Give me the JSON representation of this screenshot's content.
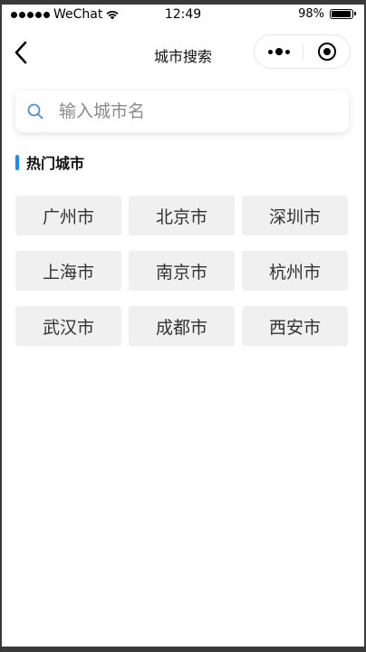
{
  "status_bar": {
    "carrier": "WeChat",
    "time": "12:49",
    "battery": "98%",
    "battery_level": 0.98
  },
  "nav": {
    "title": "城市搜索",
    "back_icon": "chevron-left-icon",
    "menu_icon": "more-dots-icon",
    "close_icon": "target-icon"
  },
  "search": {
    "placeholder": "输入城市名",
    "value": "",
    "icon": "search-icon"
  },
  "hot_cities": {
    "title": "热门城市",
    "accent_color": "#1a8cff",
    "cities": [
      "广州市",
      "北京市",
      "深圳市",
      "上海市",
      "南京市",
      "杭州市",
      "武汉市",
      "成都市",
      "西安市"
    ]
  },
  "colors": {
    "search_icon": "#4a90e2",
    "button_bg": "#f0f0f0"
  }
}
